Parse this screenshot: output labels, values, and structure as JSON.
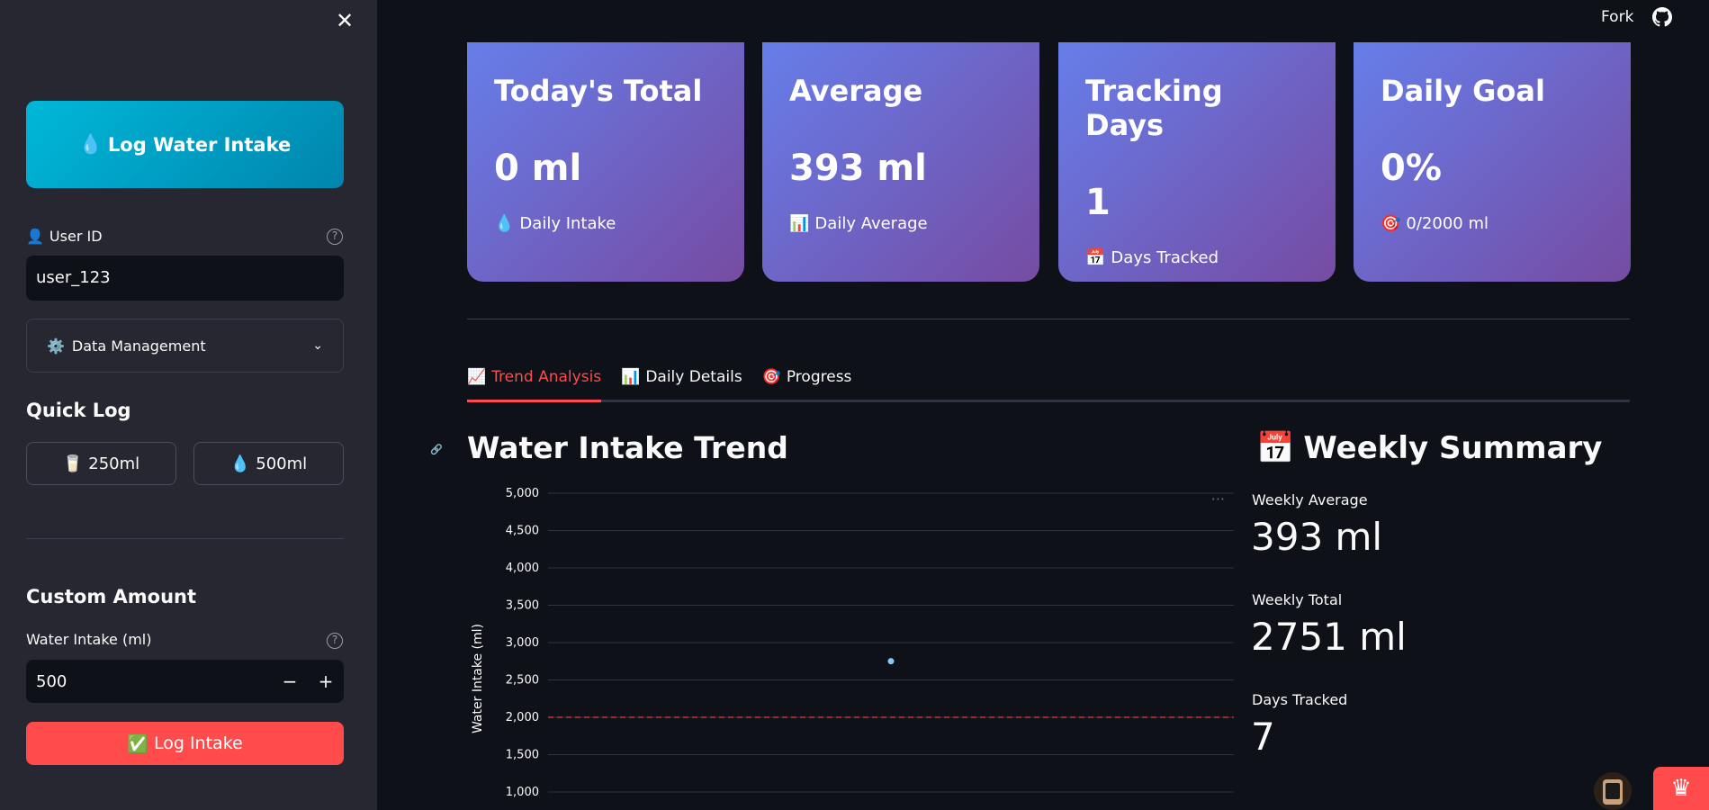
{
  "sidebar": {
    "close_icon": "close-icon",
    "log_water_button": {
      "icon": "💧",
      "label": "Log Water Intake"
    },
    "user_id": {
      "icon": "👤",
      "label": "User ID",
      "value": "user_123"
    },
    "data_management": {
      "icon": "⚙️",
      "label": "Data Management"
    },
    "quick_log": {
      "title": "Quick Log",
      "buttons": [
        {
          "icon": "🥛",
          "label": "250ml"
        },
        {
          "icon": "💧",
          "label": "500ml"
        }
      ]
    },
    "custom_amount": {
      "title": "Custom Amount",
      "field_label": "Water Intake (ml)",
      "value": "500",
      "minus": "−",
      "plus": "+"
    },
    "log_intake_button": {
      "icon": "✅",
      "label": "Log Intake"
    }
  },
  "header": {
    "fork_label": "Fork",
    "github_icon": "github-icon"
  },
  "metrics": [
    {
      "title": "Today's Total",
      "value": "0 ml",
      "icon": "💧",
      "sub": "Daily Intake"
    },
    {
      "title": "Average",
      "value": "393 ml",
      "icon": "📊",
      "sub": "Daily Average"
    },
    {
      "title": "Tracking Days",
      "value": "1",
      "icon": "📅",
      "sub": "Days Tracked"
    },
    {
      "title": "Daily Goal",
      "value": "0%",
      "icon": "🎯",
      "sub": "0/2000 ml"
    }
  ],
  "tabs": [
    {
      "icon": "📈",
      "label": "Trend Analysis",
      "active": true
    },
    {
      "icon": "📊",
      "label": "Daily Details",
      "active": false
    },
    {
      "icon": "🎯",
      "label": "Progress",
      "active": false
    }
  ],
  "chart": {
    "title": "Water Intake Trend",
    "menu": "···"
  },
  "chart_data": {
    "type": "scatter",
    "title": "Water Intake Trend",
    "xlabel": "",
    "ylabel": "Water Intake (ml)",
    "ylim": [
      1000,
      5000
    ],
    "yticks": [
      "1,000",
      "1,500",
      "2,000",
      "2,500",
      "3,000",
      "3,500",
      "4,000",
      "4,500",
      "5,000"
    ],
    "grid": true,
    "points": [
      {
        "x": 0.5,
        "y": 2751
      }
    ],
    "goal_line": {
      "y": 2000,
      "color": "#c83232",
      "style": "dashed"
    },
    "point_color": "#83c9ff"
  },
  "weekly_summary": {
    "icon": "📅",
    "title": "Weekly Summary",
    "items": [
      {
        "label": "Weekly Average",
        "value": "393 ml"
      },
      {
        "label": "Weekly Total",
        "value": "2751 ml"
      },
      {
        "label": "Days Tracked",
        "value": "7"
      }
    ]
  },
  "footer": {
    "crown_icon": "♛"
  }
}
